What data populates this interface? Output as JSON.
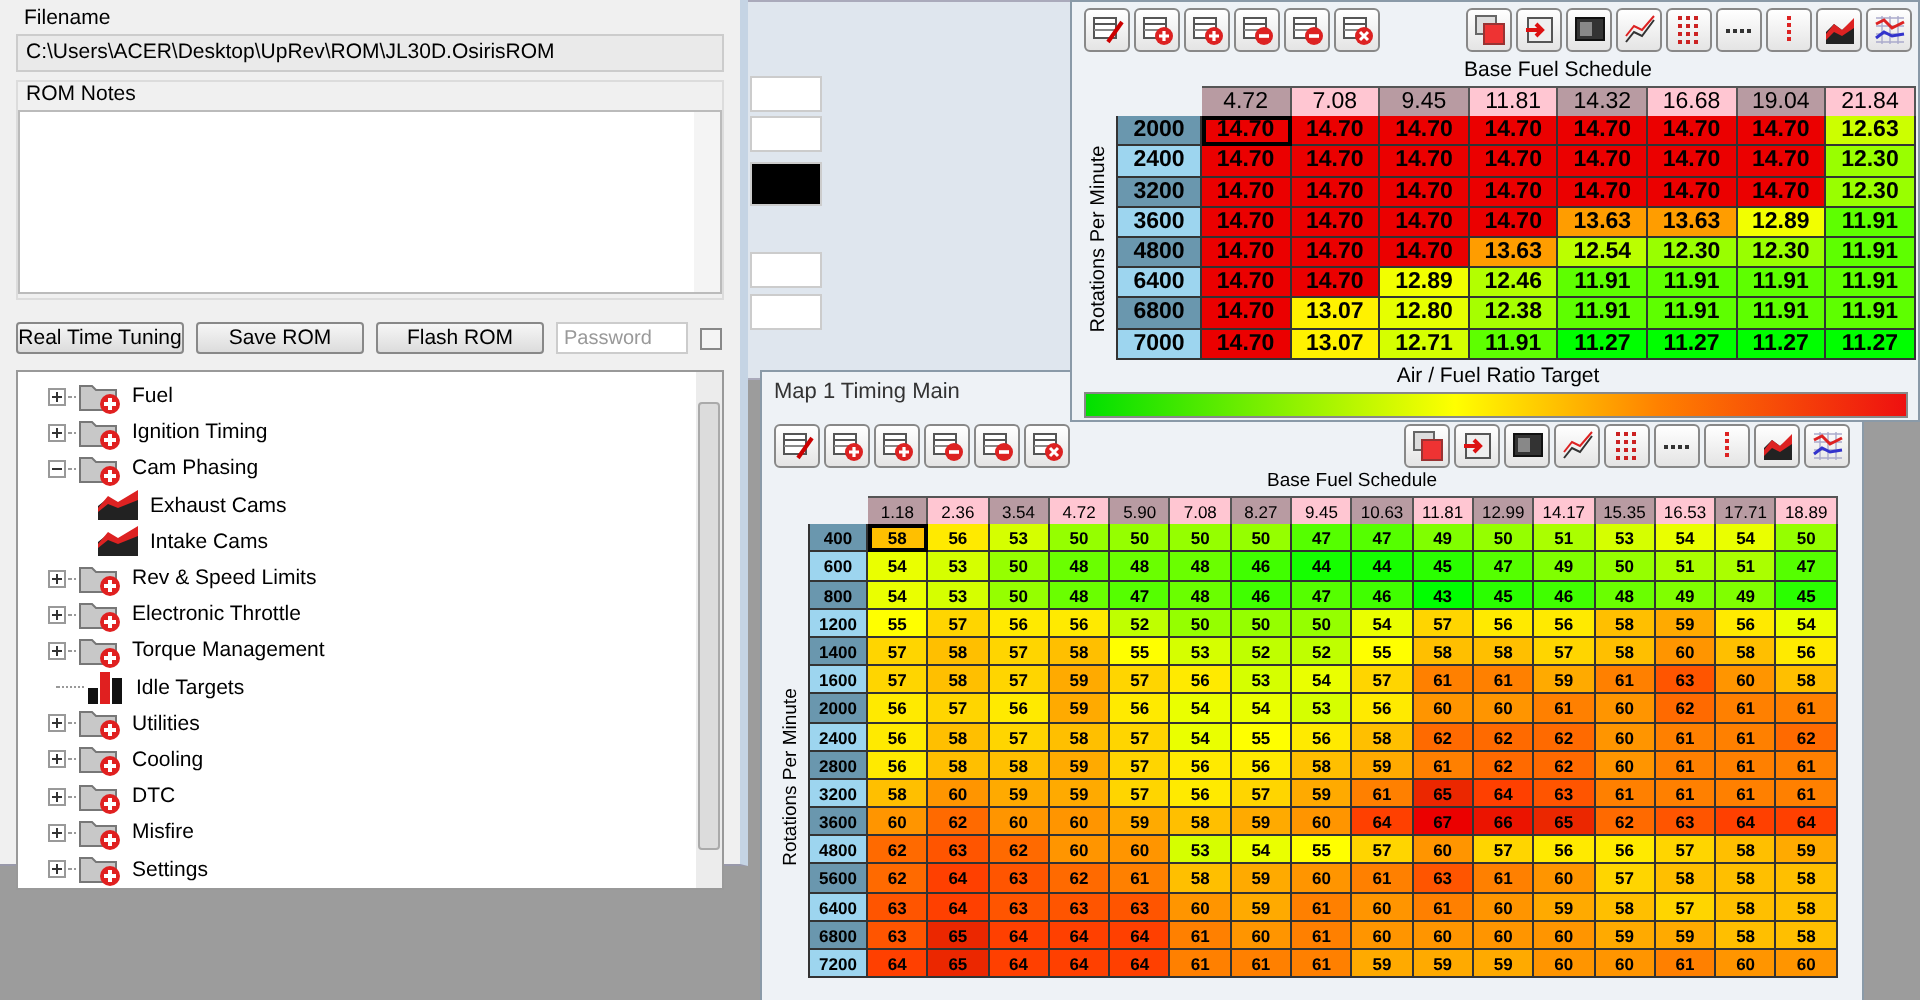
{
  "rom_window": {
    "filename_label": "Filename",
    "filename": "C:\\Users\\ACER\\Desktop\\UpRev\\ROM\\JL30D.OsirisROM",
    "notes_label": "ROM Notes",
    "buttons": [
      "Real Time Tuning",
      "Save ROM",
      "Flash ROM"
    ],
    "password": {
      "placeholder": "Password"
    },
    "password_checkbox": {
      "checked": false
    },
    "tree": [
      {
        "label": "Fuel",
        "kind": "folder",
        "expanded": false
      },
      {
        "label": "Ignition Timing",
        "kind": "folder",
        "expanded": false
      },
      {
        "label": "Cam Phasing",
        "kind": "folder",
        "expanded": true,
        "children": [
          {
            "label": "Exhaust Cams",
            "kind": "area-map"
          },
          {
            "label": "Intake Cams",
            "kind": "area-map"
          }
        ]
      },
      {
        "label": "Rev & Speed Limits",
        "kind": "folder",
        "expanded": false
      },
      {
        "label": "Electronic Throttle",
        "kind": "folder",
        "expanded": false
      },
      {
        "label": "Torque Management",
        "kind": "folder",
        "expanded": false
      },
      {
        "label": "Idle Targets",
        "kind": "bar-map"
      },
      {
        "label": "Utilities",
        "kind": "folder",
        "expanded": false
      },
      {
        "label": "Cooling",
        "kind": "folder",
        "expanded": false
      },
      {
        "label": "DTC",
        "kind": "folder",
        "expanded": false
      },
      {
        "label": "Misfire",
        "kind": "folder",
        "expanded": false
      },
      {
        "label": "Settings",
        "kind": "folder",
        "expanded": false
      }
    ]
  },
  "afr_window": {
    "x_axis_title": "Base Fuel Schedule",
    "y_axis_title": "Rotations Per Minute",
    "legend_title": "Air / Fuel Ratio Target",
    "columns": [
      "4.72",
      "7.08",
      "9.45",
      "11.81",
      "14.32",
      "16.68",
      "19.04",
      "21.84"
    ],
    "rows": [
      {
        "label": "2000",
        "values": [
          "14.70",
          "14.70",
          "14.70",
          "14.70",
          "14.70",
          "14.70",
          "14.70",
          "12.63"
        ],
        "selected": [
          true,
          false,
          false,
          false,
          false,
          false,
          false,
          false
        ]
      },
      {
        "label": "2400",
        "values": [
          "14.70",
          "14.70",
          "14.70",
          "14.70",
          "14.70",
          "14.70",
          "14.70",
          "12.30"
        ],
        "selected": [
          false,
          false,
          false,
          false,
          false,
          false,
          false,
          false
        ]
      },
      {
        "label": "3200",
        "values": [
          "14.70",
          "14.70",
          "14.70",
          "14.70",
          "14.70",
          "14.70",
          "14.70",
          "12.30"
        ],
        "selected": [
          false,
          false,
          false,
          false,
          false,
          false,
          false,
          false
        ]
      },
      {
        "label": "3600",
        "values": [
          "14.70",
          "14.70",
          "14.70",
          "14.70",
          "13.63",
          "13.63",
          "12.89",
          "11.91"
        ],
        "selected": [
          false,
          false,
          false,
          false,
          false,
          false,
          false,
          false
        ]
      },
      {
        "label": "4800",
        "values": [
          "14.70",
          "14.70",
          "14.70",
          "13.63",
          "12.54",
          "12.30",
          "12.30",
          "11.91"
        ],
        "selected": [
          false,
          false,
          false,
          false,
          false,
          false,
          false,
          false
        ]
      },
      {
        "label": "6400",
        "values": [
          "14.70",
          "14.70",
          "12.89",
          "12.46",
          "11.91",
          "11.91",
          "11.91",
          "11.91"
        ],
        "selected": [
          false,
          false,
          false,
          false,
          false,
          false,
          false,
          false
        ]
      },
      {
        "label": "6800",
        "values": [
          "14.70",
          "13.07",
          "12.80",
          "12.38",
          "11.91",
          "11.91",
          "11.91",
          "11.91"
        ],
        "selected": [
          false,
          false,
          false,
          false,
          false,
          false,
          false,
          false
        ]
      },
      {
        "label": "7000",
        "values": [
          "14.70",
          "13.07",
          "12.71",
          "11.91",
          "11.27",
          "11.27",
          "11.27",
          "11.27"
        ],
        "selected": [
          false,
          false,
          false,
          false,
          false,
          false,
          false,
          false
        ]
      }
    ]
  },
  "timing_window": {
    "title": "Map 1 Timing Main",
    "x_axis_title": "Base Fuel Schedule",
    "y_axis_title": "Rotations Per Minute",
    "columns": [
      "1.18",
      "2.36",
      "3.54",
      "4.72",
      "5.90",
      "7.08",
      "8.27",
      "9.45",
      "10.63",
      "11.81",
      "12.99",
      "14.17",
      "15.35",
      "16.53",
      "17.71",
      "18.89"
    ],
    "rows": [
      {
        "label": "400",
        "values": [
          "58",
          "56",
          "53",
          "50",
          "50",
          "50",
          "50",
          "47",
          "47",
          "49",
          "50",
          "51",
          "53",
          "54",
          "54",
          "50"
        ],
        "selected": [
          true,
          false,
          false,
          false,
          false,
          false,
          false,
          false,
          false,
          false,
          false,
          false,
          false,
          false,
          false,
          false
        ]
      },
      {
        "label": "600",
        "values": [
          "54",
          "53",
          "50",
          "48",
          "48",
          "48",
          "46",
          "44",
          "44",
          "45",
          "47",
          "49",
          "50",
          "51",
          "51",
          "47"
        ],
        "selected": [
          false,
          false,
          false,
          false,
          false,
          false,
          false,
          false,
          false,
          false,
          false,
          false,
          false,
          false,
          false,
          false
        ]
      },
      {
        "label": "800",
        "values": [
          "54",
          "53",
          "50",
          "48",
          "47",
          "48",
          "46",
          "47",
          "46",
          "43",
          "45",
          "46",
          "48",
          "49",
          "49",
          "45"
        ],
        "selected": [
          false,
          false,
          false,
          false,
          false,
          false,
          false,
          false,
          false,
          false,
          false,
          false,
          false,
          false,
          false,
          false
        ]
      },
      {
        "label": "1200",
        "values": [
          "55",
          "57",
          "56",
          "56",
          "52",
          "50",
          "50",
          "50",
          "54",
          "57",
          "56",
          "56",
          "58",
          "59",
          "56",
          "54"
        ],
        "selected": [
          false,
          false,
          false,
          false,
          false,
          false,
          false,
          false,
          false,
          false,
          false,
          false,
          false,
          false,
          false,
          false
        ]
      },
      {
        "label": "1400",
        "values": [
          "57",
          "58",
          "57",
          "58",
          "55",
          "53",
          "52",
          "52",
          "55",
          "58",
          "58",
          "57",
          "58",
          "60",
          "58",
          "56"
        ],
        "selected": [
          false,
          false,
          false,
          false,
          false,
          false,
          false,
          false,
          false,
          false,
          false,
          false,
          false,
          false,
          false,
          false
        ]
      },
      {
        "label": "1600",
        "values": [
          "57",
          "58",
          "57",
          "59",
          "57",
          "56",
          "53",
          "54",
          "57",
          "61",
          "61",
          "59",
          "61",
          "63",
          "60",
          "58"
        ],
        "selected": [
          false,
          false,
          false,
          false,
          false,
          false,
          false,
          false,
          false,
          false,
          false,
          false,
          false,
          false,
          false,
          false
        ]
      },
      {
        "label": "2000",
        "values": [
          "56",
          "57",
          "56",
          "59",
          "56",
          "54",
          "54",
          "53",
          "56",
          "60",
          "60",
          "61",
          "60",
          "62",
          "61",
          "61"
        ],
        "selected": [
          false,
          false,
          false,
          false,
          false,
          false,
          false,
          false,
          false,
          false,
          false,
          false,
          false,
          false,
          false,
          false
        ]
      },
      {
        "label": "2400",
        "values": [
          "56",
          "58",
          "57",
          "58",
          "57",
          "54",
          "55",
          "56",
          "58",
          "62",
          "62",
          "62",
          "60",
          "61",
          "61",
          "62"
        ],
        "selected": [
          false,
          false,
          false,
          false,
          false,
          false,
          false,
          false,
          false,
          false,
          false,
          false,
          false,
          false,
          false,
          false
        ]
      },
      {
        "label": "2800",
        "values": [
          "56",
          "58",
          "58",
          "59",
          "57",
          "56",
          "56",
          "58",
          "59",
          "61",
          "62",
          "62",
          "60",
          "61",
          "61",
          "61"
        ],
        "selected": [
          false,
          false,
          false,
          false,
          false,
          false,
          false,
          false,
          false,
          false,
          false,
          false,
          false,
          false,
          false,
          false
        ]
      },
      {
        "label": "3200",
        "values": [
          "58",
          "60",
          "59",
          "59",
          "57",
          "56",
          "57",
          "59",
          "61",
          "65",
          "64",
          "63",
          "61",
          "61",
          "61",
          "61"
        ],
        "selected": [
          false,
          false,
          false,
          false,
          false,
          false,
          false,
          false,
          false,
          false,
          false,
          false,
          false,
          false,
          false,
          false
        ]
      },
      {
        "label": "3600",
        "values": [
          "60",
          "62",
          "60",
          "60",
          "59",
          "58",
          "59",
          "60",
          "64",
          "67",
          "66",
          "65",
          "62",
          "63",
          "64",
          "64"
        ],
        "selected": [
          false,
          false,
          false,
          false,
          false,
          false,
          false,
          false,
          false,
          false,
          false,
          false,
          false,
          false,
          false,
          false
        ]
      },
      {
        "label": "4800",
        "values": [
          "62",
          "63",
          "62",
          "60",
          "60",
          "53",
          "54",
          "55",
          "57",
          "60",
          "57",
          "56",
          "56",
          "57",
          "58",
          "59"
        ],
        "selected": [
          false,
          false,
          false,
          false,
          false,
          false,
          false,
          false,
          false,
          false,
          false,
          false,
          false,
          false,
          false,
          false
        ]
      },
      {
        "label": "5600",
        "values": [
          "62",
          "64",
          "63",
          "62",
          "61",
          "58",
          "59",
          "60",
          "61",
          "63",
          "61",
          "60",
          "57",
          "58",
          "58",
          "58"
        ],
        "selected": [
          false,
          false,
          false,
          false,
          false,
          false,
          false,
          false,
          false,
          false,
          false,
          false,
          false,
          false,
          false,
          false
        ]
      },
      {
        "label": "6400",
        "values": [
          "63",
          "64",
          "63",
          "63",
          "63",
          "60",
          "59",
          "61",
          "60",
          "61",
          "60",
          "59",
          "58",
          "57",
          "58",
          "58"
        ],
        "selected": [
          false,
          false,
          false,
          false,
          false,
          false,
          false,
          false,
          false,
          false,
          false,
          false,
          false,
          false,
          false,
          false
        ]
      },
      {
        "label": "6800",
        "values": [
          "63",
          "65",
          "64",
          "64",
          "64",
          "61",
          "60",
          "61",
          "60",
          "60",
          "60",
          "60",
          "59",
          "59",
          "58",
          "58"
        ],
        "selected": [
          false,
          false,
          false,
          false,
          false,
          false,
          false,
          false,
          false,
          false,
          false,
          false,
          false,
          false,
          false,
          false
        ]
      },
      {
        "label": "7200",
        "values": [
          "64",
          "65",
          "64",
          "64",
          "64",
          "61",
          "61",
          "61",
          "59",
          "59",
          "59",
          "60",
          "60",
          "61",
          "60",
          "60"
        ],
        "selected": [
          false,
          false,
          false,
          false,
          false,
          false,
          false,
          false,
          false,
          false,
          false,
          false,
          false,
          false,
          false,
          false
        ]
      }
    ]
  }
}
